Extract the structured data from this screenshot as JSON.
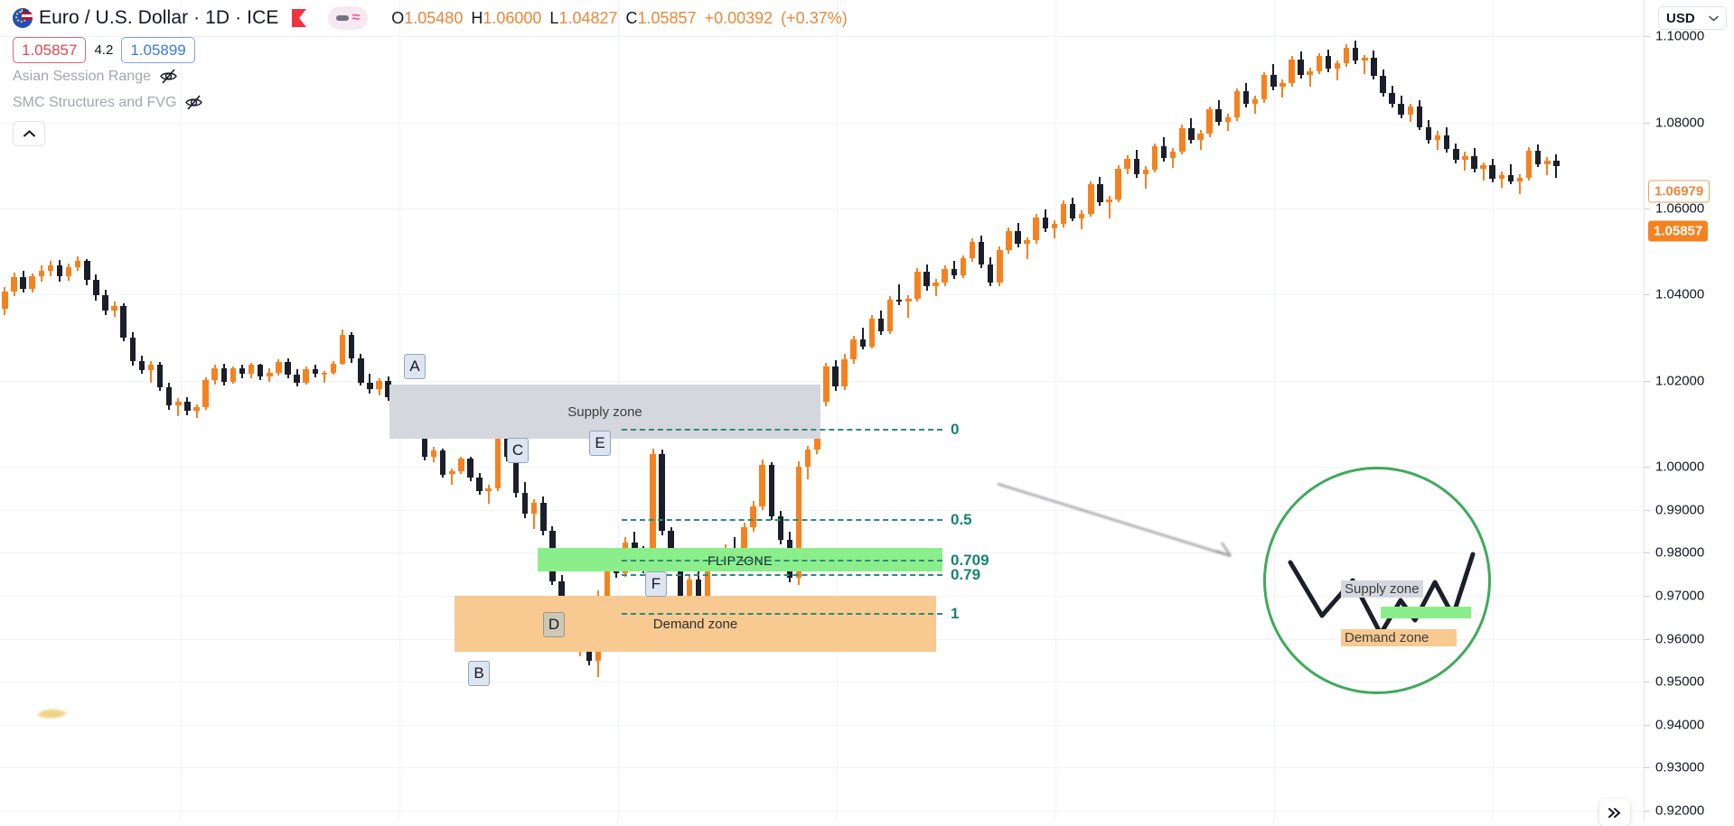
{
  "header": {
    "symbol_title": "Euro / U.S. Dollar · 1D · ICE",
    "flag_icon": "eu-us-flag-icon",
    "market_icon": "ice-exchange-icon",
    "chart_style_icon": "chart-style-toggle",
    "ohlc": {
      "o_label": "O",
      "o_value": "1.05480",
      "h_label": "H",
      "h_value": "1.06000",
      "l_label": "L",
      "l_value": "1.04827",
      "c_label": "C",
      "c_value": "1.05857",
      "change": "+0.00392",
      "change_pct": "(+0.37%)"
    },
    "bid": "1.05857",
    "spread": "4.2",
    "ask": "1.05899"
  },
  "indicators": [
    {
      "name": "Asian Session Range",
      "visibility_icon": "eye-crossed-icon"
    },
    {
      "name": "SMC Structures and FVG",
      "visibility_icon": "eye-crossed-icon"
    }
  ],
  "collapse_button": {
    "icon": "chevron-up-icon"
  },
  "realtime_button": {
    "icon": "double-chevron-right-icon"
  },
  "price_scale": {
    "currency": "USD",
    "currency_chevron_icon": "chevron-down-icon",
    "ticks": [
      "1.10000",
      "1.08000",
      "1.06000",
      "1.04000",
      "1.02000",
      "1.00000",
      "0.99000",
      "0.98000",
      "0.97000",
      "0.96000",
      "0.95000",
      "0.94000",
      "0.93000",
      "0.92000"
    ],
    "last_price_badge": "1.05857",
    "prev_close_badge": "1.06979",
    "last_color": "#f58220",
    "prev_color": "#e8883a"
  },
  "zones": [
    {
      "label": "Supply zone",
      "color": "#d4d7de"
    },
    {
      "label": "Demand zone",
      "color": "#f8c990"
    },
    {
      "label": "FLIPZONE",
      "color": "#8aee8a"
    }
  ],
  "fib_levels": [
    {
      "label": "0",
      "color": "#16846f"
    },
    {
      "label": "0.5",
      "color": "#16846f"
    },
    {
      "label": "0.709",
      "color": "#16846f"
    },
    {
      "label": "0.79",
      "color": "#16846f"
    },
    {
      "label": "1",
      "color": "#16846f"
    }
  ],
  "markers": [
    {
      "label": "A"
    },
    {
      "label": "B"
    },
    {
      "label": "C"
    },
    {
      "label": "D"
    },
    {
      "label": "E"
    },
    {
      "label": "F"
    }
  ],
  "inset": {
    "circle_color": "#3faa5a",
    "supply_label": "Supply zone",
    "demand_label": "Demand zone"
  },
  "chart_data": {
    "type": "candlestick",
    "title": "Euro / U.S. Dollar · 1D · ICE",
    "ylabel": "USD",
    "ylim": [
      0.9175,
      1.1085
    ],
    "grid": true,
    "up_color": "#f58220",
    "down_color": "#1b1f2b",
    "last_price": 1.05857,
    "prev_close": 1.06979,
    "annotations": {
      "supply_zone": [
        1.001,
        1.0195
      ],
      "demand_zone": [
        0.9546,
        0.9685
      ],
      "flip_zone": [
        0.9732,
        0.9804
      ],
      "fib": {
        "0": 1.001,
        "0.5": 0.9876,
        "0.709": 0.977,
        "0.79": 0.9731,
        "1": 0.9605
      }
    },
    "ohlc": [
      [
        1.0381,
        1.0399,
        1.0358,
        1.0367
      ],
      [
        1.0367,
        1.0418,
        1.0352,
        1.0408
      ],
      [
        1.0408,
        1.0452,
        1.0396,
        1.0441
      ],
      [
        1.0441,
        1.0455,
        1.0405,
        1.0414
      ],
      [
        1.0414,
        1.0448,
        1.0404,
        1.0442
      ],
      [
        1.0442,
        1.0468,
        1.0431,
        1.0455
      ],
      [
        1.0455,
        1.0478,
        1.0443,
        1.0468
      ],
      [
        1.0468,
        1.048,
        1.043,
        1.0443
      ],
      [
        1.0443,
        1.0472,
        1.0432,
        1.0463
      ],
      [
        1.0463,
        1.0488,
        1.0455,
        1.0478
      ],
      [
        1.0478,
        1.0482,
        1.0422,
        1.0434
      ],
      [
        1.0434,
        1.0446,
        1.0386,
        1.0398
      ],
      [
        1.0398,
        1.0412,
        1.0352,
        1.0362
      ],
      [
        1.0362,
        1.0384,
        1.0348,
        1.0374
      ],
      [
        1.0374,
        1.038,
        1.0292,
        1.03
      ],
      [
        1.03,
        1.0312,
        1.0235,
        1.0245
      ],
      [
        1.0245,
        1.0258,
        1.0216,
        1.0224
      ],
      [
        1.0224,
        1.0245,
        1.0196,
        1.0238
      ],
      [
        1.0238,
        1.0244,
        1.0176,
        1.0184
      ],
      [
        1.0184,
        1.0196,
        1.0132,
        1.0143
      ],
      [
        1.0143,
        1.016,
        1.0118,
        1.0152
      ],
      [
        1.0152,
        1.0162,
        1.012,
        1.0131
      ],
      [
        1.0131,
        1.0145,
        1.0113,
        1.0139
      ],
      [
        1.0139,
        1.0208,
        1.0133,
        1.0202
      ],
      [
        1.0202,
        1.0236,
        1.019,
        1.0229
      ],
      [
        1.0229,
        1.024,
        1.0188,
        1.0197
      ],
      [
        1.0197,
        1.0233,
        1.0192,
        1.0228
      ],
      [
        1.0228,
        1.0238,
        1.0206,
        1.0216
      ],
      [
        1.0216,
        1.0242,
        1.0206,
        1.0236
      ],
      [
        1.0236,
        1.024,
        1.0202,
        1.021
      ],
      [
        1.021,
        1.0228,
        1.0198,
        1.0219
      ],
      [
        1.0219,
        1.025,
        1.0212,
        1.0244
      ],
      [
        1.0244,
        1.0252,
        1.0206,
        1.0214
      ],
      [
        1.0214,
        1.0226,
        1.0186,
        1.0196
      ],
      [
        1.0196,
        1.0232,
        1.019,
        1.0226
      ],
      [
        1.0226,
        1.0238,
        1.0208,
        1.0216
      ],
      [
        1.0216,
        1.0222,
        1.0196,
        1.0218
      ],
      [
        1.0218,
        1.0246,
        1.0214,
        1.024
      ],
      [
        1.024,
        1.0318,
        1.0236,
        1.0306
      ],
      [
        1.0306,
        1.0312,
        1.0242,
        1.0252
      ],
      [
        1.0252,
        1.0262,
        1.0188,
        1.0196
      ],
      [
        1.0196,
        1.0216,
        1.017,
        1.018
      ],
      [
        1.018,
        1.0206,
        1.0166,
        1.02
      ],
      [
        1.02,
        1.021,
        1.0154,
        1.0162
      ],
      [
        1.0162,
        1.0172,
        1.0104,
        1.0112
      ],
      [
        1.0112,
        1.0128,
        1.0084,
        1.012
      ],
      [
        1.012,
        1.0132,
        1.0072,
        1.008
      ],
      [
        1.008,
        1.0096,
        1.0014,
        1.0022
      ],
      [
        1.0022,
        1.0046,
        1.001,
        1.0038
      ],
      [
        1.0038,
        1.0042,
        0.9974,
        0.9982
      ],
      [
        0.9982,
        0.9996,
        0.9958,
        0.999
      ],
      [
        0.999,
        1.0024,
        0.9984,
        1.0018
      ],
      [
        1.0018,
        1.0022,
        0.9966,
        0.9974
      ],
      [
        0.9974,
        0.9986,
        0.9934,
        0.9944
      ],
      [
        0.9944,
        0.9958,
        0.9914,
        0.995
      ],
      [
        0.995,
        1.0184,
        0.9944,
        1.016
      ],
      [
        1.016,
        1.019,
        1.0012,
        1.0022
      ],
      [
        1.0022,
        1.0032,
        0.9928,
        0.9938
      ],
      [
        0.9938,
        0.9964,
        0.988,
        0.989
      ],
      [
        0.989,
        0.9924,
        0.9856,
        0.9916
      ],
      [
        0.9916,
        0.993,
        0.984,
        0.985
      ],
      [
        0.985,
        0.9862,
        0.9724,
        0.9734
      ],
      [
        0.9734,
        0.9748,
        0.9652,
        0.966
      ],
      [
        0.966,
        0.969,
        0.9596,
        0.9606
      ],
      [
        0.9606,
        0.964,
        0.956,
        0.963
      ],
      [
        0.963,
        0.966,
        0.9538,
        0.9548
      ],
      [
        0.9548,
        0.9712,
        0.951,
        0.97
      ],
      [
        0.97,
        0.9802,
        0.969,
        0.979
      ],
      [
        0.979,
        0.981,
        0.9742,
        0.9752
      ],
      [
        0.9752,
        0.9836,
        0.9744,
        0.9824
      ],
      [
        0.9824,
        0.9848,
        0.9788,
        0.9796
      ],
      [
        0.9796,
        0.9816,
        0.9752,
        0.976
      ],
      [
        0.976,
        1.0042,
        0.9752,
        1.003
      ],
      [
        1.003,
        1.004,
        0.984,
        0.985
      ],
      [
        0.985,
        0.986,
        0.9756,
        0.9766
      ],
      [
        0.9766,
        0.9786,
        0.969,
        0.97
      ],
      [
        0.97,
        0.9748,
        0.967,
        0.9738
      ],
      [
        0.9738,
        0.9758,
        0.9688,
        0.9696
      ],
      [
        0.9696,
        0.978,
        0.9664,
        0.977
      ],
      [
        0.977,
        0.981,
        0.9758,
        0.98
      ],
      [
        0.98,
        0.982,
        0.976,
        0.9812
      ],
      [
        0.9812,
        0.9836,
        0.9794,
        0.9802
      ],
      [
        0.9802,
        0.987,
        0.9796,
        0.986
      ],
      [
        0.986,
        0.992,
        0.9848,
        0.9908
      ],
      [
        0.9908,
        1.0016,
        0.99,
        1.0004
      ],
      [
        1.0004,
        1.001,
        0.9876,
        0.9884
      ],
      [
        0.9884,
        0.9898,
        0.982,
        0.983
      ],
      [
        0.983,
        0.9848,
        0.9732,
        0.9742
      ],
      [
        0.9742,
        1.0012,
        0.9724,
        1.0
      ],
      [
        1.0,
        1.0048,
        0.997,
        1.004
      ],
      [
        1.004,
        1.016,
        1.003,
        1.015
      ],
      [
        1.015,
        1.0242,
        1.014,
        1.0232
      ],
      [
        1.0232,
        1.0248,
        1.0176,
        1.0186
      ],
      [
        1.0186,
        1.0262,
        1.0178,
        1.025
      ],
      [
        1.025,
        1.0304,
        1.024,
        1.0296
      ],
      [
        1.0296,
        1.0324,
        1.0272,
        1.028
      ],
      [
        1.028,
        1.0352,
        1.0274,
        1.0344
      ],
      [
        1.0344,
        1.0362,
        1.0306,
        1.0314
      ],
      [
        1.0314,
        1.0396,
        1.0308,
        1.0388
      ],
      [
        1.0388,
        1.0424,
        1.0376,
        1.0384
      ],
      [
        1.0384,
        1.0398,
        1.0346,
        1.039
      ],
      [
        1.039,
        1.0462,
        1.0384,
        1.0454
      ],
      [
        1.0454,
        1.047,
        1.041,
        1.042
      ],
      [
        1.042,
        1.0436,
        1.0396,
        1.0428
      ],
      [
        1.0428,
        1.0468,
        1.042,
        1.046
      ],
      [
        1.046,
        1.0478,
        1.0436,
        1.0444
      ],
      [
        1.0444,
        1.0492,
        1.0438,
        1.0484
      ],
      [
        1.0484,
        1.053,
        1.0476,
        1.0522
      ],
      [
        1.0522,
        1.0538,
        1.0462,
        1.047
      ],
      [
        1.047,
        1.0486,
        1.042,
        1.0428
      ],
      [
        1.0428,
        1.0512,
        1.042,
        1.0504
      ],
      [
        1.0504,
        1.0556,
        1.0496,
        1.0548
      ],
      [
        1.0548,
        1.0566,
        1.051,
        1.0518
      ],
      [
        1.0518,
        1.0534,
        1.0482,
        1.0526
      ],
      [
        1.0526,
        1.0588,
        1.0518,
        1.058
      ],
      [
        1.058,
        1.0598,
        1.0546,
        1.0554
      ],
      [
        1.0554,
        1.0572,
        1.053,
        1.0564
      ],
      [
        1.0564,
        1.0618,
        1.0556,
        1.061
      ],
      [
        1.061,
        1.0626,
        1.057,
        1.0578
      ],
      [
        1.0578,
        1.0596,
        1.0552,
        1.0588
      ],
      [
        1.0588,
        1.0664,
        1.0582,
        1.0656
      ],
      [
        1.0656,
        1.0674,
        1.0606,
        1.0614
      ],
      [
        1.0614,
        1.063,
        1.0578,
        1.0622
      ],
      [
        1.0622,
        1.07,
        1.0614,
        1.0692
      ],
      [
        1.0692,
        1.0724,
        1.068,
        1.0716
      ],
      [
        1.0716,
        1.0736,
        1.0672,
        1.068
      ],
      [
        1.068,
        1.0698,
        1.0646,
        1.069
      ],
      [
        1.069,
        1.0752,
        1.0684,
        1.0744
      ],
      [
        1.0744,
        1.0766,
        1.071,
        1.0718
      ],
      [
        1.0718,
        1.074,
        1.0694,
        1.0732
      ],
      [
        1.0732,
        1.0796,
        1.0726,
        1.0788
      ],
      [
        1.0788,
        1.081,
        1.0752,
        1.076
      ],
      [
        1.076,
        1.0782,
        1.0736,
        1.0774
      ],
      [
        1.0774,
        1.0838,
        1.0766,
        1.083
      ],
      [
        1.083,
        1.0852,
        1.0794,
        1.0802
      ],
      [
        1.0802,
        1.082,
        1.078,
        1.0812
      ],
      [
        1.0812,
        1.088,
        1.0804,
        1.0872
      ],
      [
        1.0872,
        1.0892,
        1.0836,
        1.0844
      ],
      [
        1.0844,
        1.0862,
        1.082,
        1.0854
      ],
      [
        1.0854,
        1.0918,
        1.0846,
        1.091
      ],
      [
        1.091,
        1.0936,
        1.0876,
        1.0884
      ],
      [
        1.0884,
        1.09,
        1.0858,
        1.0892
      ],
      [
        1.0892,
        1.0954,
        1.0884,
        1.0946
      ],
      [
        1.0946,
        1.0966,
        1.0902,
        1.091
      ],
      [
        1.091,
        1.0928,
        1.0884,
        1.092
      ],
      [
        1.092,
        1.0962,
        1.0912,
        1.0954
      ],
      [
        1.0954,
        1.097,
        1.0918,
        1.0926
      ],
      [
        1.0926,
        1.0944,
        1.0898,
        1.0938
      ],
      [
        1.0938,
        1.0982,
        1.093,
        1.0974
      ],
      [
        1.0974,
        1.099,
        1.0936,
        1.0944
      ],
      [
        1.0944,
        1.0958,
        1.0912,
        1.095
      ],
      [
        1.095,
        1.0968,
        1.09,
        1.0908
      ],
      [
        1.0908,
        1.0924,
        1.086,
        1.0868
      ],
      [
        1.0868,
        1.0886,
        1.0836,
        1.0844
      ],
      [
        1.0844,
        1.0862,
        1.081,
        1.0818
      ],
      [
        1.0818,
        1.0844,
        1.0802,
        1.0838
      ],
      [
        1.0838,
        1.0852,
        1.0782,
        1.079
      ],
      [
        1.079,
        1.0806,
        1.0752,
        1.076
      ],
      [
        1.076,
        1.078,
        1.0736,
        1.077
      ],
      [
        1.077,
        1.079,
        1.073,
        1.0738
      ],
      [
        1.0738,
        1.0752,
        1.0706,
        1.0714
      ],
      [
        1.0714,
        1.0732,
        1.0688,
        1.0722
      ],
      [
        1.0722,
        1.074,
        1.0684,
        1.0692
      ],
      [
        1.0692,
        1.0708,
        1.0666,
        1.07
      ],
      [
        1.07,
        1.0716,
        1.0662,
        1.067
      ],
      [
        1.067,
        1.0686,
        1.0648,
        1.0678
      ],
      [
        1.0678,
        1.0702,
        1.0656,
        1.0664
      ],
      [
        1.0664,
        1.068,
        1.0634,
        1.0672
      ],
      [
        1.0672,
        1.0742,
        1.0666,
        1.0734
      ],
      [
        1.0734,
        1.075,
        1.0696,
        1.0704
      ],
      [
        1.0704,
        1.072,
        1.0678,
        1.0712
      ],
      [
        1.0712,
        1.0726,
        1.0672,
        1.0698
      ]
    ]
  }
}
